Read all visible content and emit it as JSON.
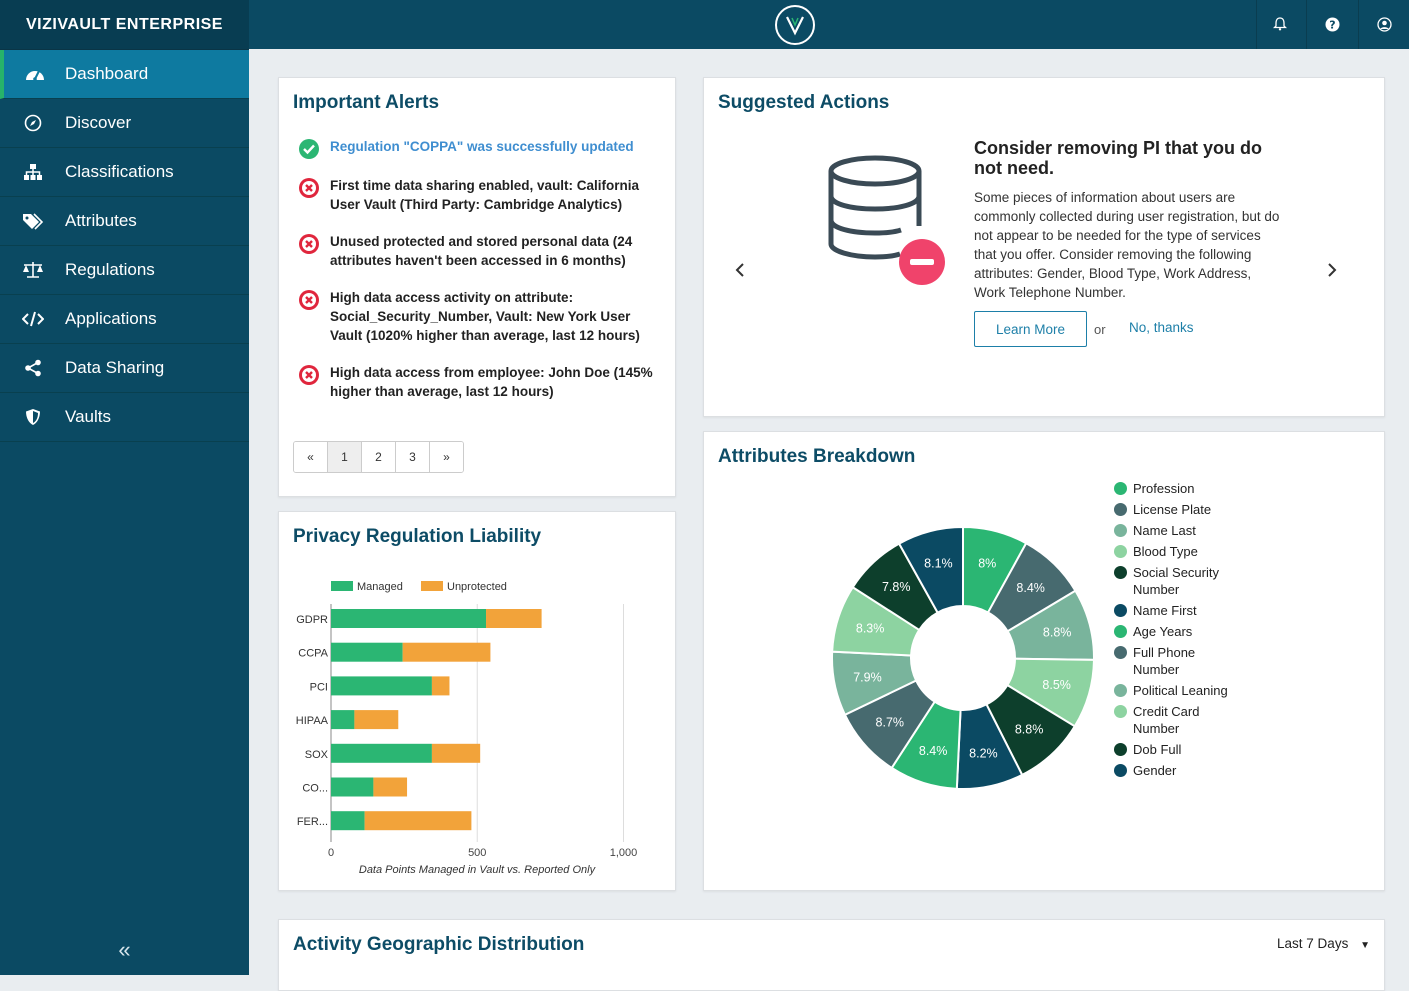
{
  "app": {
    "brand": "VIZIVAULT ENTERPRISE"
  },
  "sidebar": {
    "items": [
      {
        "label": "Dashboard",
        "icon": "dashboard-icon",
        "active": true
      },
      {
        "label": "Discover",
        "icon": "compass-icon"
      },
      {
        "label": "Classifications",
        "icon": "sitemap-icon"
      },
      {
        "label": "Attributes",
        "icon": "tags-icon"
      },
      {
        "label": "Regulations",
        "icon": "balance-scale-icon"
      },
      {
        "label": "Applications",
        "icon": "code-icon"
      },
      {
        "label": "Data Sharing",
        "icon": "share-icon"
      },
      {
        "label": "Vaults",
        "icon": "shield-icon"
      }
    ],
    "collapse": "«"
  },
  "topbar": {
    "icons": [
      "bell-icon",
      "help-icon",
      "user-icon"
    ]
  },
  "alerts": {
    "title": "Important Alerts",
    "items": [
      {
        "status": "success",
        "text": "Regulation \"COPPA\" was successfully updated"
      },
      {
        "status": "error",
        "text": "First time data sharing enabled, vault: California User Vault (Third Party: Cambridge Analytics)"
      },
      {
        "status": "error",
        "text": "Unused protected and stored personal data (24 attributes haven't been accessed in 6 months)"
      },
      {
        "status": "error",
        "text": "High data access activity on attribute: Social_Security_Number, Vault: New York User Vault (1020% higher than average, last 12 hours)"
      },
      {
        "status": "error",
        "text": "High data access from employee: John Doe (145% higher than average, last 12 hours)"
      }
    ],
    "pager": {
      "first": "«",
      "pages": [
        "1",
        "2",
        "3"
      ],
      "last": "»",
      "current": "1"
    }
  },
  "suggested": {
    "title": "Suggested Actions",
    "heading": "Consider removing PI that you do not need.",
    "body": "Some pieces of information about users are commonly collected during user registration, but do not appear to be needed for the type of services that you offer. Consider removing the following attributes: Gender, Blood Type, Work Address, Work Telephone Number.",
    "learn_more": "Learn More",
    "or": "or",
    "no_thanks": "No, thanks",
    "prev": "‹",
    "next": "›"
  },
  "liability": {
    "title": "Privacy Regulation Liability",
    "chart_data": {
      "type": "bar",
      "orientation": "horizontal",
      "stacked": true,
      "categories": [
        "GDPR",
        "CCPA",
        "PCI",
        "HIPAA",
        "SOX",
        "CO...",
        "FER..."
      ],
      "series": [
        {
          "name": "Managed",
          "color": "#2bb673",
          "values": [
            530,
            245,
            345,
            80,
            345,
            145,
            115
          ]
        },
        {
          "name": "Unprotected",
          "color": "#f2a33a",
          "values": [
            190,
            300,
            60,
            150,
            165,
            115,
            365
          ]
        }
      ],
      "xlim": [
        0,
        1000
      ],
      "xticks": [
        "0",
        "500",
        "1,000"
      ],
      "xlabel": "Data Points Managed in Vault vs. Reported Only",
      "legend": "top"
    }
  },
  "breakdown": {
    "title": "Attributes Breakdown",
    "chart_data": {
      "type": "pie",
      "donut": true,
      "slices": [
        {
          "name": "Profession",
          "value": 8,
          "label": "8%",
          "color": "#2bb673"
        },
        {
          "name": "License Plate",
          "value": 8.4,
          "label": "8.4%",
          "color": "#476a6f"
        },
        {
          "name": "Name Last",
          "value": 8.8,
          "label": "8.8%",
          "color": "#79b49c"
        },
        {
          "name": "Blood Type",
          "value": 8.5,
          "label": "8.5%",
          "color": "#8dd3a1"
        },
        {
          "name": "Social Security Number",
          "value": 8.8,
          "label": "8.8%",
          "color": "#0d3f2c"
        },
        {
          "name": "Name First",
          "value": 8.2,
          "label": "8.2%",
          "color": "#0b4a63"
        },
        {
          "name": "Age Years",
          "value": 8.4,
          "label": "8.4%",
          "color": "#2bb673"
        },
        {
          "name": "Full Phone Number",
          "value": 8.7,
          "label": "8.7%",
          "color": "#476a6f"
        },
        {
          "name": "Political Leaning",
          "value": 7.9,
          "label": "7.9%",
          "color": "#79b49c"
        },
        {
          "name": "Credit Card Number",
          "value": 8.3,
          "label": "8.3%",
          "color": "#8dd3a1"
        },
        {
          "name": "Dob Full",
          "value": 7.8,
          "label": "7.8%",
          "color": "#0d3f2c"
        },
        {
          "name": "Gender",
          "value": 8.1,
          "label": "8.1%",
          "color": "#0b4a63"
        }
      ],
      "legend": "right"
    }
  },
  "geo": {
    "title": "Activity Geographic Distribution",
    "range": "Last 7 Days"
  }
}
